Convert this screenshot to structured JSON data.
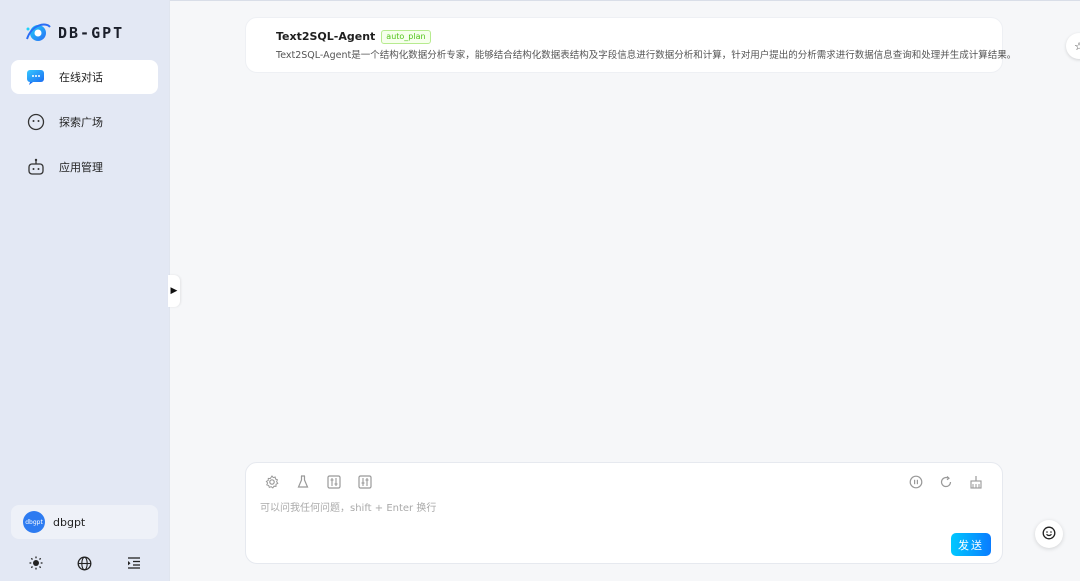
{
  "app": {
    "logo_text": "DB-GPT"
  },
  "sidebar": {
    "items": [
      {
        "label": "在线对话",
        "icon": "chat-icon",
        "active": true
      },
      {
        "label": "探索广场",
        "icon": "explore-icon",
        "active": false
      },
      {
        "label": "应用管理",
        "icon": "robot-icon",
        "active": false
      }
    ],
    "user": {
      "avatar_text": "dbgpt",
      "name": "dbgpt"
    },
    "bottom_icons": [
      "sun-icon",
      "globe-icon",
      "menu-fold-icon"
    ]
  },
  "agent": {
    "name": "Text2SQL-Agent",
    "tag": "auto_plan",
    "description": "Text2SQL-Agent是一个结构化数据分析专家，能够结合结构化数据表结构及字段信息进行数据分析和计算，针对用户提出的分析需求进行数据信息查询和处理并生成计算结果。"
  },
  "input": {
    "placeholder": "可以问我任何问题，shift + Enter 换行",
    "value": "",
    "send_label": "发送",
    "tools_left": [
      "settings-icon",
      "flask-icon",
      "sliders-icon",
      "adjust-icon"
    ],
    "tools_right": [
      "pause-icon",
      "refresh-icon",
      "clear-icon"
    ]
  },
  "colors": {
    "accent": "#0a7cff",
    "sidebar_bg": "#e3e8f4",
    "tag_green": "#52c41a"
  }
}
